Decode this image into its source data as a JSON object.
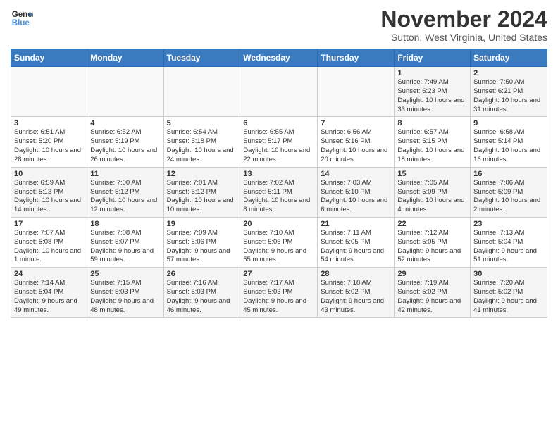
{
  "header": {
    "logo": {
      "line1": "General",
      "line2": "Blue"
    },
    "title": "November 2024",
    "subtitle": "Sutton, West Virginia, United States"
  },
  "days_of_week": [
    "Sunday",
    "Monday",
    "Tuesday",
    "Wednesday",
    "Thursday",
    "Friday",
    "Saturday"
  ],
  "weeks": [
    [
      {
        "day": "",
        "info": ""
      },
      {
        "day": "",
        "info": ""
      },
      {
        "day": "",
        "info": ""
      },
      {
        "day": "",
        "info": ""
      },
      {
        "day": "",
        "info": ""
      },
      {
        "day": "1",
        "info": "Sunrise: 7:49 AM\nSunset: 6:23 PM\nDaylight: 10 hours and 33 minutes."
      },
      {
        "day": "2",
        "info": "Sunrise: 7:50 AM\nSunset: 6:21 PM\nDaylight: 10 hours and 31 minutes."
      }
    ],
    [
      {
        "day": "3",
        "info": "Sunrise: 6:51 AM\nSunset: 5:20 PM\nDaylight: 10 hours and 28 minutes."
      },
      {
        "day": "4",
        "info": "Sunrise: 6:52 AM\nSunset: 5:19 PM\nDaylight: 10 hours and 26 minutes."
      },
      {
        "day": "5",
        "info": "Sunrise: 6:54 AM\nSunset: 5:18 PM\nDaylight: 10 hours and 24 minutes."
      },
      {
        "day": "6",
        "info": "Sunrise: 6:55 AM\nSunset: 5:17 PM\nDaylight: 10 hours and 22 minutes."
      },
      {
        "day": "7",
        "info": "Sunrise: 6:56 AM\nSunset: 5:16 PM\nDaylight: 10 hours and 20 minutes."
      },
      {
        "day": "8",
        "info": "Sunrise: 6:57 AM\nSunset: 5:15 PM\nDaylight: 10 hours and 18 minutes."
      },
      {
        "day": "9",
        "info": "Sunrise: 6:58 AM\nSunset: 5:14 PM\nDaylight: 10 hours and 16 minutes."
      }
    ],
    [
      {
        "day": "10",
        "info": "Sunrise: 6:59 AM\nSunset: 5:13 PM\nDaylight: 10 hours and 14 minutes."
      },
      {
        "day": "11",
        "info": "Sunrise: 7:00 AM\nSunset: 5:12 PM\nDaylight: 10 hours and 12 minutes."
      },
      {
        "day": "12",
        "info": "Sunrise: 7:01 AM\nSunset: 5:12 PM\nDaylight: 10 hours and 10 minutes."
      },
      {
        "day": "13",
        "info": "Sunrise: 7:02 AM\nSunset: 5:11 PM\nDaylight: 10 hours and 8 minutes."
      },
      {
        "day": "14",
        "info": "Sunrise: 7:03 AM\nSunset: 5:10 PM\nDaylight: 10 hours and 6 minutes."
      },
      {
        "day": "15",
        "info": "Sunrise: 7:05 AM\nSunset: 5:09 PM\nDaylight: 10 hours and 4 minutes."
      },
      {
        "day": "16",
        "info": "Sunrise: 7:06 AM\nSunset: 5:09 PM\nDaylight: 10 hours and 2 minutes."
      }
    ],
    [
      {
        "day": "17",
        "info": "Sunrise: 7:07 AM\nSunset: 5:08 PM\nDaylight: 10 hours and 1 minute."
      },
      {
        "day": "18",
        "info": "Sunrise: 7:08 AM\nSunset: 5:07 PM\nDaylight: 9 hours and 59 minutes."
      },
      {
        "day": "19",
        "info": "Sunrise: 7:09 AM\nSunset: 5:06 PM\nDaylight: 9 hours and 57 minutes."
      },
      {
        "day": "20",
        "info": "Sunrise: 7:10 AM\nSunset: 5:06 PM\nDaylight: 9 hours and 55 minutes."
      },
      {
        "day": "21",
        "info": "Sunrise: 7:11 AM\nSunset: 5:05 PM\nDaylight: 9 hours and 54 minutes."
      },
      {
        "day": "22",
        "info": "Sunrise: 7:12 AM\nSunset: 5:05 PM\nDaylight: 9 hours and 52 minutes."
      },
      {
        "day": "23",
        "info": "Sunrise: 7:13 AM\nSunset: 5:04 PM\nDaylight: 9 hours and 51 minutes."
      }
    ],
    [
      {
        "day": "24",
        "info": "Sunrise: 7:14 AM\nSunset: 5:04 PM\nDaylight: 9 hours and 49 minutes."
      },
      {
        "day": "25",
        "info": "Sunrise: 7:15 AM\nSunset: 5:03 PM\nDaylight: 9 hours and 48 minutes."
      },
      {
        "day": "26",
        "info": "Sunrise: 7:16 AM\nSunset: 5:03 PM\nDaylight: 9 hours and 46 minutes."
      },
      {
        "day": "27",
        "info": "Sunrise: 7:17 AM\nSunset: 5:03 PM\nDaylight: 9 hours and 45 minutes."
      },
      {
        "day": "28",
        "info": "Sunrise: 7:18 AM\nSunset: 5:02 PM\nDaylight: 9 hours and 43 minutes."
      },
      {
        "day": "29",
        "info": "Sunrise: 7:19 AM\nSunset: 5:02 PM\nDaylight: 9 hours and 42 minutes."
      },
      {
        "day": "30",
        "info": "Sunrise: 7:20 AM\nSunset: 5:02 PM\nDaylight: 9 hours and 41 minutes."
      }
    ]
  ]
}
